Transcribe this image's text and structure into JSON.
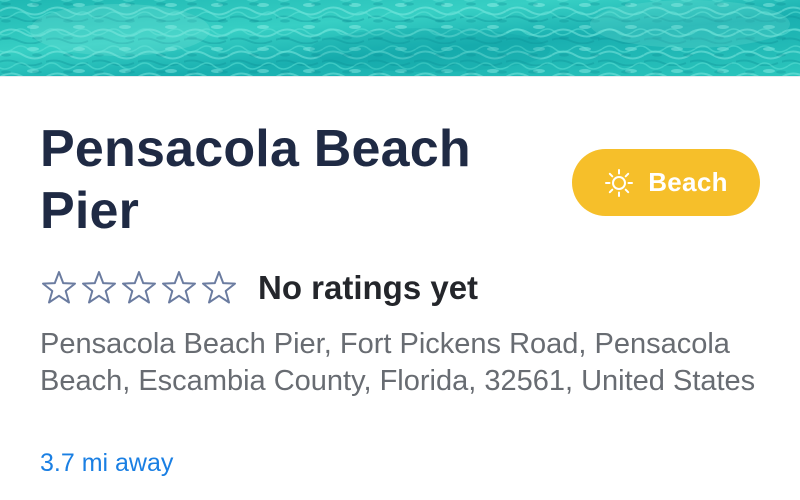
{
  "hero": {
    "image_description": "turquoise ocean water"
  },
  "place": {
    "name": "Pensacola Beach Pier",
    "category": {
      "label": "Beach",
      "icon": "sun-icon",
      "color": "#f6bf2a"
    },
    "rating": {
      "stars_filled": 0,
      "stars_total": 5,
      "text": "No ratings yet"
    },
    "address": "Pensacola Beach Pier, Fort Pickens Road, Pensacola Beach, Escambia County, Florida, 32561, United States",
    "distance": "3.7 mi away"
  },
  "colors": {
    "title": "#1f2a44",
    "address": "#686c72",
    "link": "#1a7fe3",
    "star_outline": "#6b7ca0",
    "water_light": "#5fd9d2",
    "water_dark": "#0e9fa6"
  }
}
